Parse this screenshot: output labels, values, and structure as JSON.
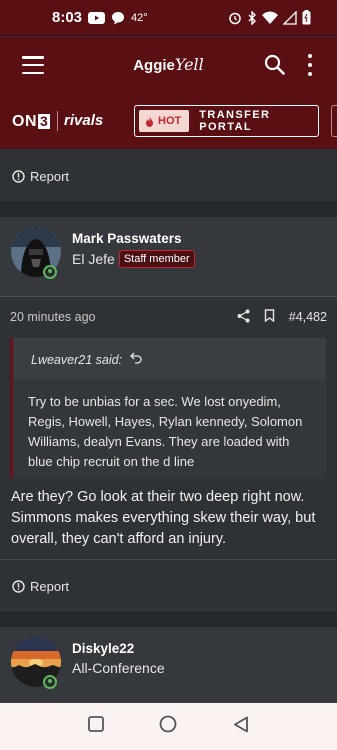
{
  "status_bar": {
    "time": "8:03",
    "temperature": "42°"
  },
  "app_header": {
    "logo_main": "Aggie",
    "logo_script": "Yell"
  },
  "brand_bar": {
    "on3": "ON",
    "on3_num": "3",
    "rivals": "rivals",
    "hot_label": "HOT",
    "transfer_label": "TRANSFER PORTAL"
  },
  "post1": {
    "report_label": "Report"
  },
  "post2": {
    "author": "Mark Passwaters",
    "user_title": "El Jefe",
    "badge": "Staff member",
    "timestamp": "20 minutes ago",
    "post_number": "#4,482",
    "quote_author": "Lweaver21 said:",
    "quote_text": "Try to be unbias for a sec. We lost onyedim, Regis, Howell, Hayes, Rylan kennedy, Solomon Williams, dealyn Evans. They are loaded with blue chip recruit on the d line",
    "body": "Are they? Go look at their two deep right now. Simmons makes everything skew their way, but overall, they can't afford an injury.",
    "report_label": "Report"
  },
  "post3": {
    "author": "Diskyle22",
    "user_title": "All-Conference"
  },
  "colors": {
    "header": "#5a0f12",
    "background": "#2e3136",
    "online": "#5cb85c",
    "badge_border": "#c1272d"
  }
}
